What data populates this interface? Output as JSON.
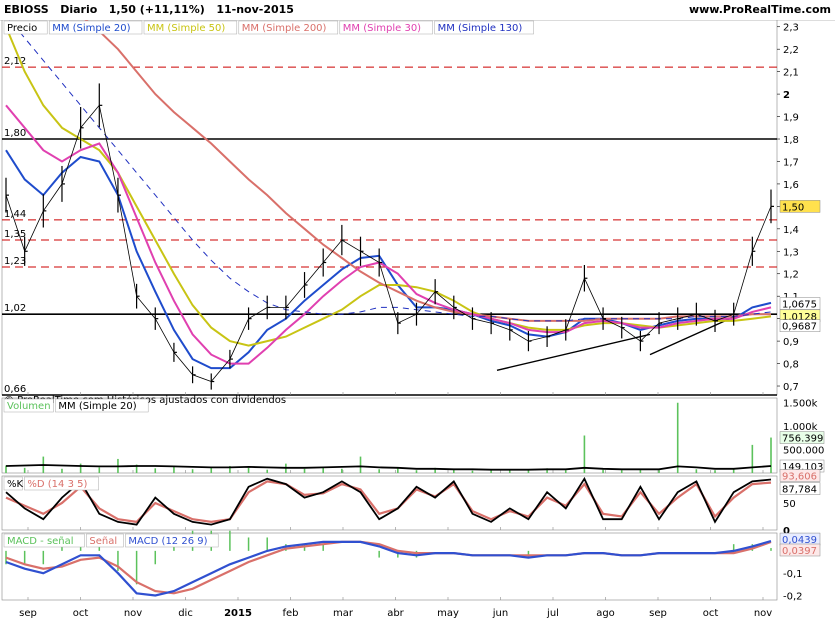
{
  "header": {
    "symbol": "EBIOSS",
    "timeframe": "Diario",
    "price": "1,50 (+11,11%)",
    "date": "11-nov-2015",
    "website": "www.ProRealTime.com"
  },
  "colors": {
    "price": "#000000",
    "mm20": "#1f4ccc",
    "mm50": "#c8c414",
    "mm200": "#d9706a",
    "mm30": "#e040b0",
    "mm130": "#2030c0",
    "volume": "#5cc25c",
    "k": "#000000",
    "d": "#d9706a",
    "macd_hist": "#5cc25c",
    "signal": "#d9706a",
    "macd": "#3050d0",
    "level_red": "#cc0000"
  },
  "chart_data": [
    {
      "type": "line",
      "title": "",
      "legend": [
        "Precio",
        "MM (Simple 20)",
        "MM (Simple 50)",
        "MM (Simple 200)",
        "MM (Simple 30)",
        "MM (Simple 130)"
      ],
      "y_ticks": [
        "2,3",
        "2,2",
        "2,1",
        "2",
        "1,9",
        "1,8",
        "1,7",
        "1,6",
        "1,5",
        "1,4",
        "1,3",
        "1,2",
        "1,1",
        "1",
        "0,9",
        "0,8",
        "0,7"
      ],
      "ylim": [
        0.66,
        2.33
      ],
      "level_lines": [
        {
          "label": "2,12",
          "value": 2.12,
          "color": "red-dashed"
        },
        {
          "label": "1,80",
          "value": 1.8,
          "color": "black"
        },
        {
          "label": "1,44",
          "value": 1.44,
          "color": "red-dashed"
        },
        {
          "label": "1,35",
          "value": 1.35,
          "color": "red-dashed"
        },
        {
          "label": "1,23",
          "value": 1.23,
          "color": "red-dashed"
        },
        {
          "label": "1,02",
          "value": 1.02,
          "color": "black"
        },
        {
          "label": "0,66",
          "value": 0.66,
          "color": "black"
        }
      ],
      "right_labels": [
        {
          "text": "1,50",
          "value": 1.5,
          "bg": "#ffe14d"
        },
        {
          "text": "1,0675",
          "value": 1.0675,
          "bg": "#ffffff"
        },
        {
          "text": "1,0128",
          "value": 1.0128,
          "bg": "#ffff99"
        },
        {
          "text": "0,9687",
          "value": 0.9687,
          "bg": "#ffffff"
        }
      ],
      "months": [
        "sep",
        "oct",
        "nov",
        "dic",
        "2015",
        "feb",
        "mar",
        "abr",
        "may",
        "jun",
        "jul",
        "ago",
        "sep",
        "oct",
        "nov"
      ],
      "series": [
        {
          "name": "Precio",
          "values": [
            1.55,
            1.3,
            1.48,
            1.6,
            1.85,
            1.95,
            1.55,
            1.1,
            1.0,
            0.85,
            0.75,
            0.72,
            0.82,
            1.0,
            1.05,
            1.05,
            1.15,
            1.25,
            1.35,
            1.3,
            1.25,
            0.98,
            1.02,
            1.12,
            1.05,
            1.0,
            0.98,
            0.95,
            0.9,
            0.92,
            0.95,
            1.18,
            1.0,
            0.96,
            0.9,
            0.98,
            1.0,
            1.02,
            0.99,
            1.02,
            1.3,
            1.5
          ]
        },
        {
          "name": "MM (Simple 20)",
          "values": [
            1.75,
            1.62,
            1.55,
            1.65,
            1.72,
            1.7,
            1.55,
            1.3,
            1.12,
            0.95,
            0.82,
            0.78,
            0.78,
            0.85,
            0.95,
            1.0,
            1.08,
            1.15,
            1.22,
            1.27,
            1.28,
            1.15,
            1.05,
            1.05,
            1.04,
            1.02,
            0.99,
            0.97,
            0.93,
            0.92,
            0.94,
            1.0,
            1.0,
            0.98,
            0.95,
            0.97,
            0.99,
            1.0,
            1.0,
            1.0,
            1.05,
            1.07
          ]
        },
        {
          "name": "MM (Simple 50)",
          "values": [
            2.3,
            2.1,
            1.95,
            1.85,
            1.8,
            1.75,
            1.65,
            1.5,
            1.35,
            1.2,
            1.06,
            0.96,
            0.9,
            0.88,
            0.9,
            0.92,
            0.96,
            1.0,
            1.04,
            1.1,
            1.15,
            1.15,
            1.14,
            1.12,
            1.08,
            1.03,
            1.0,
            0.98,
            0.96,
            0.95,
            0.95,
            0.97,
            0.98,
            0.98,
            0.97,
            0.96,
            0.97,
            0.98,
            0.99,
            0.99,
            1.0,
            1.01
          ]
        },
        {
          "name": "MM (Simple 200)",
          "values": [
            2.6,
            2.55,
            2.5,
            2.42,
            2.35,
            2.28,
            2.2,
            2.1,
            2.0,
            1.92,
            1.85,
            1.78,
            1.7,
            1.62,
            1.55,
            1.47,
            1.4,
            1.33,
            1.27,
            1.21,
            1.16,
            1.12,
            1.08,
            1.05,
            1.03,
            1.02,
            1.01,
            1.0,
            0.99,
            0.99,
            0.99,
            0.99,
            1.0,
            1.0,
            1.0,
            1.0,
            1.01,
            1.01,
            1.01,
            1.01,
            1.02,
            1.02
          ]
        },
        {
          "name": "MM (Simple 30)",
          "values": [
            1.95,
            1.85,
            1.75,
            1.7,
            1.75,
            1.78,
            1.65,
            1.45,
            1.25,
            1.08,
            0.93,
            0.84,
            0.8,
            0.8,
            0.87,
            0.95,
            1.02,
            1.1,
            1.17,
            1.23,
            1.25,
            1.2,
            1.11,
            1.07,
            1.04,
            1.02,
            1.0,
            0.98,
            0.95,
            0.94,
            0.94,
            0.98,
            0.99,
            0.98,
            0.96,
            0.96,
            0.98,
            0.99,
            1.0,
            1.0,
            1.03,
            1.05
          ]
        },
        {
          "name": "MM (Simple 130)",
          "values": [
            2.35,
            2.25,
            2.15,
            2.05,
            1.95,
            1.85,
            1.75,
            1.65,
            1.55,
            1.45,
            1.35,
            1.26,
            1.18,
            1.12,
            1.07,
            1.04,
            1.03,
            1.02,
            1.02,
            1.03,
            1.05,
            1.05,
            1.04,
            1.03,
            1.02,
            1.01,
            1.01,
            1.0,
            0.99,
            0.99,
            0.99,
            1.0,
            1.0,
            1.0,
            1.0,
            1.0,
            1.0,
            1.01,
            1.01,
            1.01,
            1.02,
            1.03
          ]
        }
      ],
      "note": "© ProRealTime.com  Históricos ajustados con dividendos"
    },
    {
      "type": "bar",
      "legend": [
        "Volumen",
        "MM (Simple 20)"
      ],
      "y_ticks": [
        "1.500k",
        "1.000k",
        "500.000",
        "0"
      ],
      "ylim": [
        0,
        1600000
      ],
      "right_labels": [
        "756.399",
        "149.103"
      ],
      "volume_values": [
        160000,
        110000,
        350000,
        90000,
        200000,
        120000,
        300000,
        180000,
        100000,
        140000,
        80000,
        130000,
        150000,
        110000,
        70000,
        200000,
        90000,
        120000,
        90000,
        350000,
        80000,
        100000,
        60000,
        110000,
        90000,
        50000,
        70000,
        60000,
        80000,
        100000,
        60000,
        800000,
        70000,
        60000,
        90000,
        60000,
        1500000,
        80000,
        60000,
        90000,
        600000,
        756399
      ],
      "ma_values": [
        150000,
        160000,
        170000,
        160000,
        150000,
        140000,
        140000,
        150000,
        150000,
        140000,
        130000,
        120000,
        120000,
        130000,
        120000,
        110000,
        110000,
        120000,
        130000,
        140000,
        120000,
        110000,
        90000,
        90000,
        80000,
        80000,
        70000,
        70000,
        70000,
        80000,
        80000,
        110000,
        90000,
        80000,
        80000,
        80000,
        140000,
        120000,
        90000,
        90000,
        120000,
        149103
      ]
    },
    {
      "type": "line",
      "legend": [
        "%K",
        "%D (14 3 5)"
      ],
      "y_ticks": [
        "100",
        "50",
        "0"
      ],
      "ylim": [
        0,
        100
      ],
      "right_labels": [
        "93,606",
        "87,784"
      ],
      "series": [
        {
          "name": "%K",
          "values": [
            70,
            40,
            20,
            60,
            90,
            30,
            15,
            10,
            60,
            30,
            15,
            10,
            20,
            80,
            95,
            85,
            60,
            70,
            90,
            70,
            20,
            40,
            80,
            60,
            90,
            30,
            15,
            40,
            20,
            70,
            40,
            95,
            20,
            20,
            80,
            20,
            70,
            90,
            15,
            70,
            90,
            93.606
          ]
        },
        {
          "name": "%D (14 3 5)",
          "values": [
            60,
            45,
            30,
            50,
            80,
            40,
            20,
            15,
            50,
            35,
            20,
            15,
            20,
            70,
            90,
            85,
            65,
            68,
            85,
            75,
            30,
            40,
            75,
            62,
            85,
            35,
            20,
            35,
            25,
            60,
            45,
            85,
            30,
            25,
            70,
            30,
            60,
            85,
            25,
            60,
            85,
            87.784
          ]
        }
      ]
    },
    {
      "type": "line",
      "legend": [
        "MACD - señal",
        "Señal",
        "MACD (12 26 9)"
      ],
      "y_ticks": [
        "0",
        "-0,1",
        "-0,2"
      ],
      "ylim": [
        -0.22,
        0.08
      ],
      "right_labels": [
        "0,0439",
        "0,0397"
      ],
      "series": [
        {
          "name": "MACD (12 26 9)",
          "values": [
            -0.05,
            -0.08,
            -0.1,
            -0.06,
            -0.02,
            -0.02,
            -0.1,
            -0.19,
            -0.2,
            -0.18,
            -0.14,
            -0.1,
            -0.06,
            -0.03,
            0.0,
            0.02,
            0.03,
            0.04,
            0.04,
            0.04,
            0.02,
            -0.01,
            -0.02,
            -0.01,
            -0.01,
            -0.02,
            -0.02,
            -0.02,
            -0.03,
            -0.02,
            -0.02,
            -0.01,
            -0.01,
            -0.02,
            -0.02,
            -0.01,
            -0.01,
            -0.01,
            -0.01,
            0.0,
            0.02,
            0.0439
          ]
        },
        {
          "name": "Señal",
          "values": [
            -0.03,
            -0.06,
            -0.08,
            -0.07,
            -0.04,
            -0.03,
            -0.07,
            -0.14,
            -0.18,
            -0.19,
            -0.17,
            -0.13,
            -0.09,
            -0.05,
            -0.02,
            0.01,
            0.02,
            0.03,
            0.04,
            0.04,
            0.03,
            0.0,
            -0.01,
            -0.01,
            -0.01,
            -0.02,
            -0.02,
            -0.02,
            -0.02,
            -0.02,
            -0.02,
            -0.01,
            -0.01,
            -0.02,
            -0.02,
            -0.01,
            -0.01,
            -0.01,
            -0.01,
            -0.01,
            0.01,
            0.0397
          ]
        }
      ]
    }
  ]
}
